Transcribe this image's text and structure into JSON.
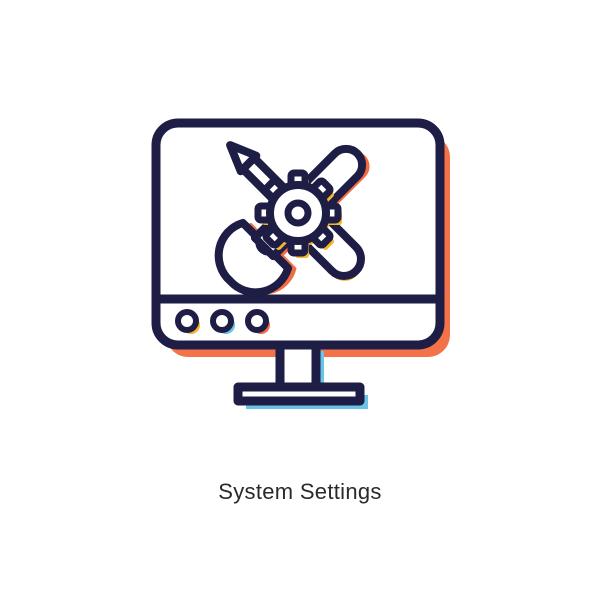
{
  "caption": "System Settings",
  "icon": {
    "name": "system-settings-icon",
    "colors": {
      "outline": "#1d1d45",
      "orange": "#f26a3f",
      "yellow": "#f6b52e",
      "blue": "#6cc3e8",
      "white": "#ffffff"
    }
  }
}
